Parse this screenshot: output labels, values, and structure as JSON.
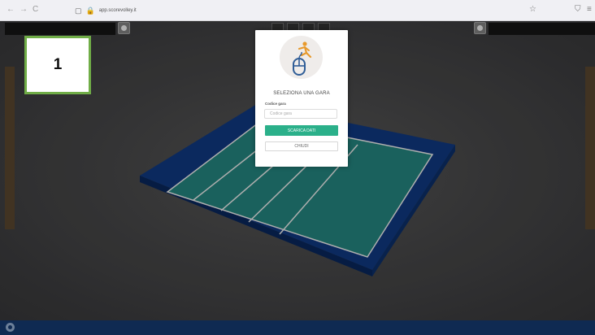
{
  "browser": {
    "url": "app.scorevolley.it",
    "back_icon": "←",
    "forward_icon": "→",
    "reload_icon": "C",
    "page_icon": "▢",
    "lock_icon": "🔒",
    "star_icon": "☆",
    "shield_icon": "⛉",
    "menu_icon": "≡"
  },
  "step_badge": {
    "number": "1"
  },
  "modal": {
    "title": "SELEZIONA UNA GARA",
    "field_label": "Codice gara",
    "field_placeholder": "Codice gara",
    "primary_button": "SCARICA DATI",
    "secondary_button": "CHIUDI"
  },
  "colors": {
    "accent": "#2bb08a",
    "court_outer": "#0d2f6b",
    "court_inner": "#1e6f6a",
    "badge_border": "#70ad47",
    "bottom_bar": "#0f2a52"
  }
}
